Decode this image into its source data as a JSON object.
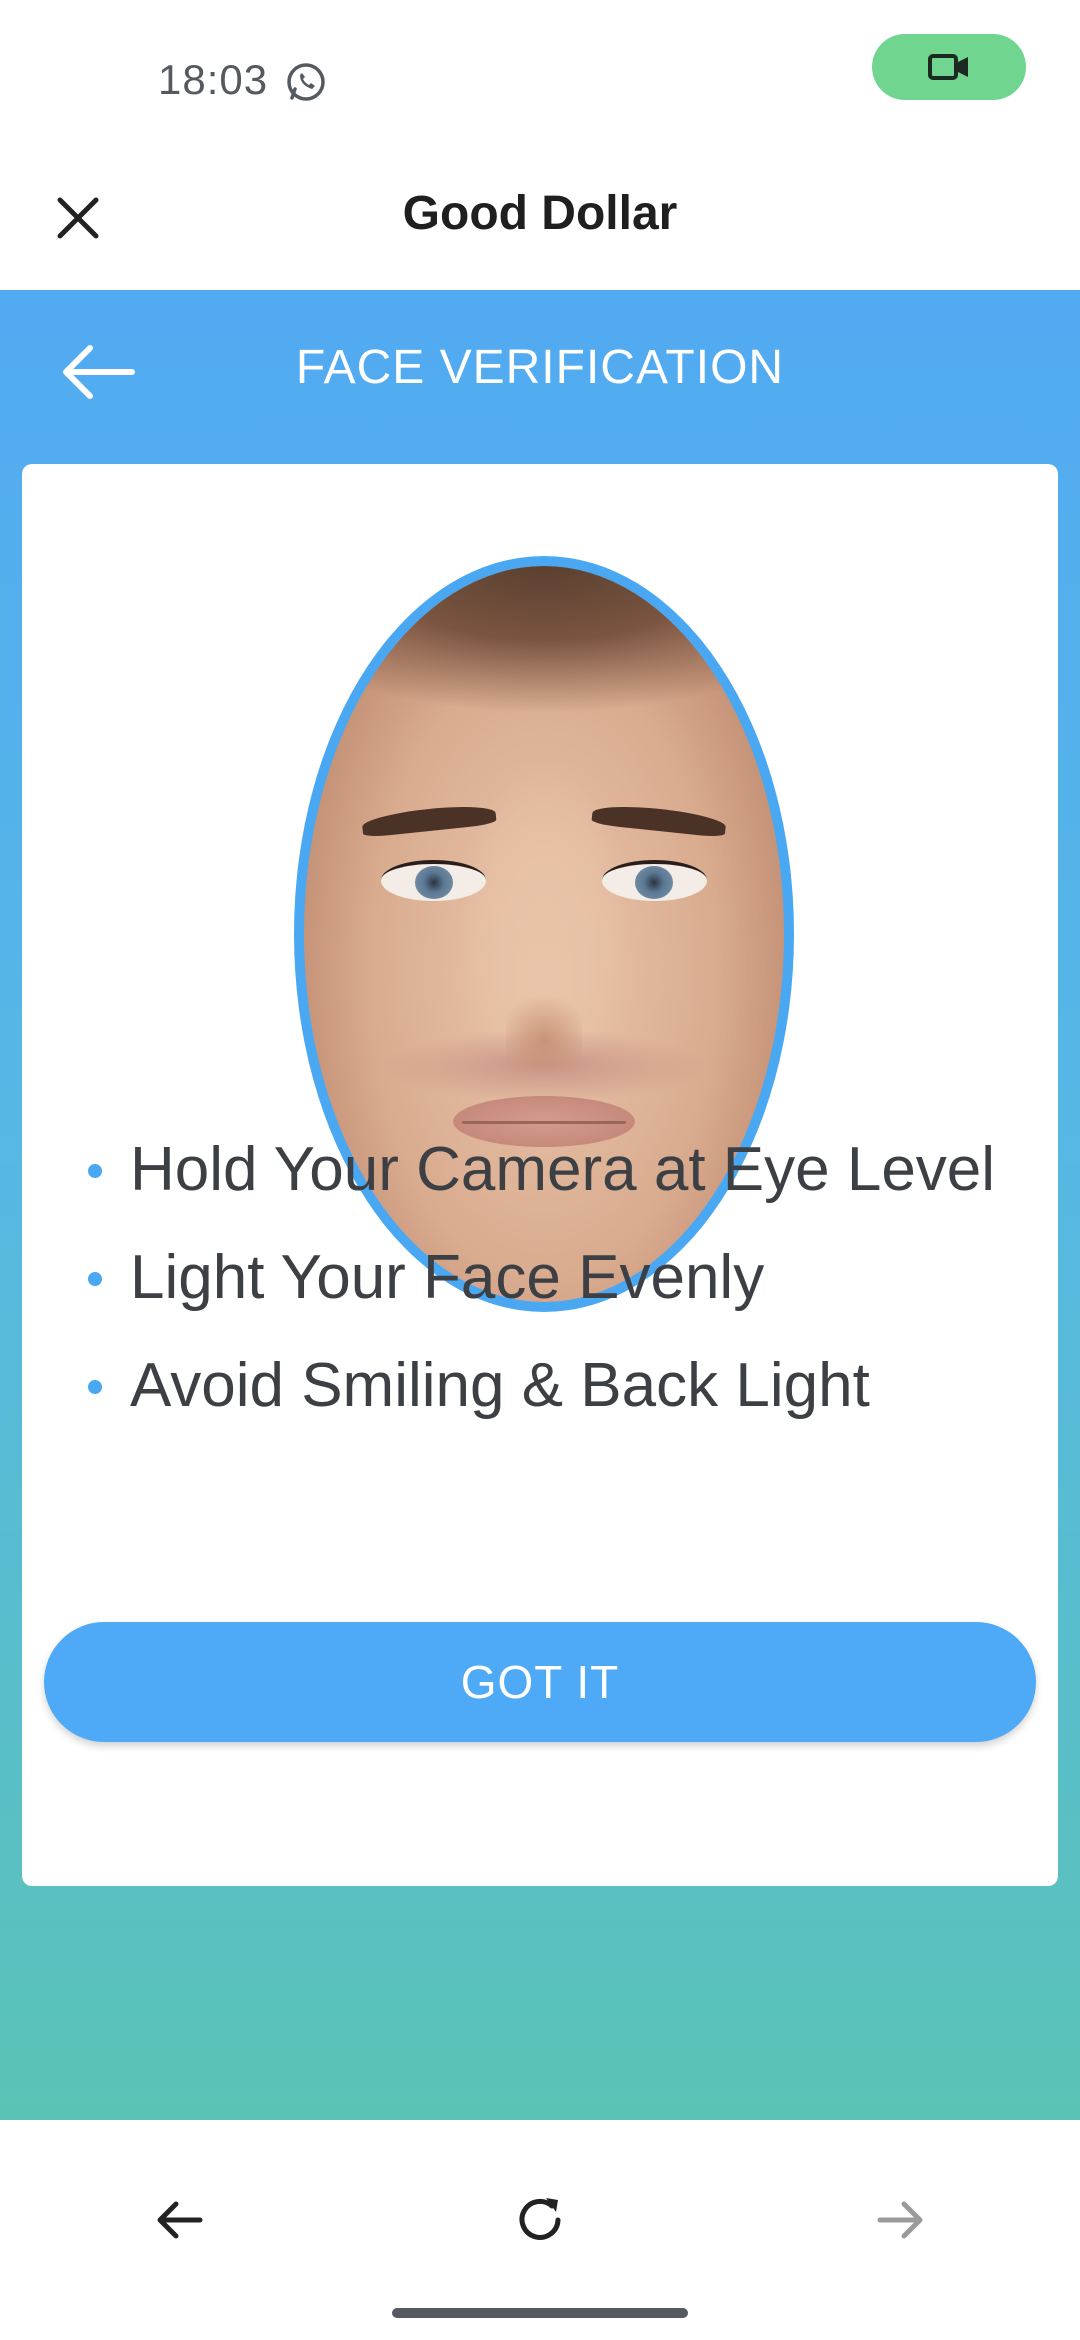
{
  "status_bar": {
    "time": "18:03",
    "notification_icon": "whatsapp-icon",
    "indicator_icon": "video-camera-icon",
    "indicator_color": "#6fd58f"
  },
  "app_header": {
    "title": "Good Dollar",
    "close_icon": "close-icon"
  },
  "verification": {
    "title": "FACE VERIFICATION",
    "back_icon": "arrow-left-icon",
    "image": "face-photo",
    "tips": [
      "Hold Your Camera at Eye Level",
      "Light Your Face Evenly",
      "Avoid Smiling & Back Light"
    ],
    "button_label": "GOT IT"
  },
  "browser_nav": {
    "back_icon": "arrow-left-icon",
    "reload_icon": "reload-icon",
    "forward_icon": "arrow-right-icon"
  },
  "colors": {
    "accent": "#4eaaf6",
    "gradient_top": "#52aaf2",
    "gradient_bottom": "#5bc3b6",
    "text_dark": "#3c3f44"
  }
}
